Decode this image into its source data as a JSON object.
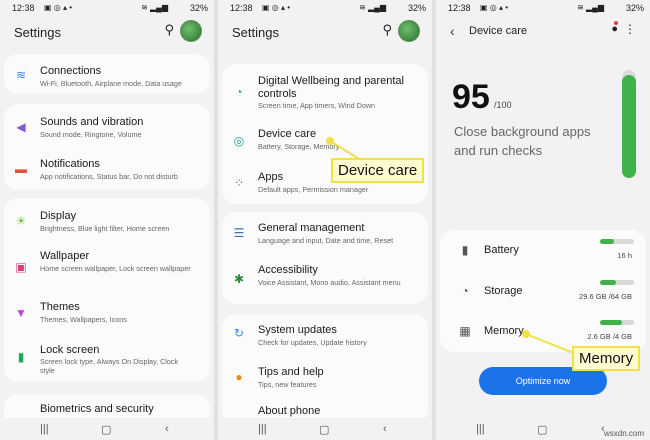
{
  "status": {
    "time": "12:38",
    "battery": "32%"
  },
  "settings": {
    "title": "Settings",
    "items": [
      {
        "title": "Connections",
        "sub": "Wi-Fi, Bluetooth, Airplane mode, Data usage"
      },
      {
        "title": "Sounds and vibration",
        "sub": "Sound mode, Ringtone, Volume"
      },
      {
        "title": "Notifications",
        "sub": "App notifications, Status bar, Do not disturb"
      },
      {
        "title": "Display",
        "sub": "Brightness, Blue light filter, Home screen"
      },
      {
        "title": "Wallpaper",
        "sub": "Home screen wallpaper, Lock screen wallpaper"
      },
      {
        "title": "Themes",
        "sub": "Themes, Wallpapers, Icons"
      },
      {
        "title": "Lock screen",
        "sub": "Screen lock type, Always On Display, Clock style"
      },
      {
        "title": "Biometrics and security",
        "sub": ""
      }
    ]
  },
  "settings2": {
    "title": "Settings",
    "items": [
      {
        "title": "Digital Wellbeing and parental controls",
        "sub": "Screen time, App timers, Wind Down"
      },
      {
        "title": "Device care",
        "sub": "Battery, Storage, Memory"
      },
      {
        "title": "Apps",
        "sub": "Default apps, Permission manager"
      },
      {
        "title": "General management",
        "sub": "Language and input, Date and time, Reset"
      },
      {
        "title": "Accessibility",
        "sub": "Voice Assistant, Mono audio, Assistant menu"
      },
      {
        "title": "System updates",
        "sub": "Check for updates, Update history"
      },
      {
        "title": "Tips and help",
        "sub": "Tips, new features"
      },
      {
        "title": "About phone",
        "sub": ""
      }
    ],
    "callout": "Device care"
  },
  "device_care": {
    "title": "Device care",
    "score": "95",
    "score_max": "/100",
    "description": "Close background apps and run checks",
    "score_fraction": 0.95,
    "rows": [
      {
        "label": "Battery",
        "value": "16 h",
        "fill": 0.4
      },
      {
        "label": "Storage",
        "value": "29.6 GB /64 GB",
        "fill": 0.46
      },
      {
        "label": "Memory",
        "value": "2.6 GB /4 GB",
        "fill": 0.65
      }
    ],
    "optimize_label": "Optimize now",
    "callout": "Memory"
  },
  "watermark": "wsxdn.com",
  "colors": {
    "accent": "#1a73e8",
    "green": "#3fb24a",
    "callout_bg": "#fefbd0",
    "callout_border": "#f2e045"
  }
}
